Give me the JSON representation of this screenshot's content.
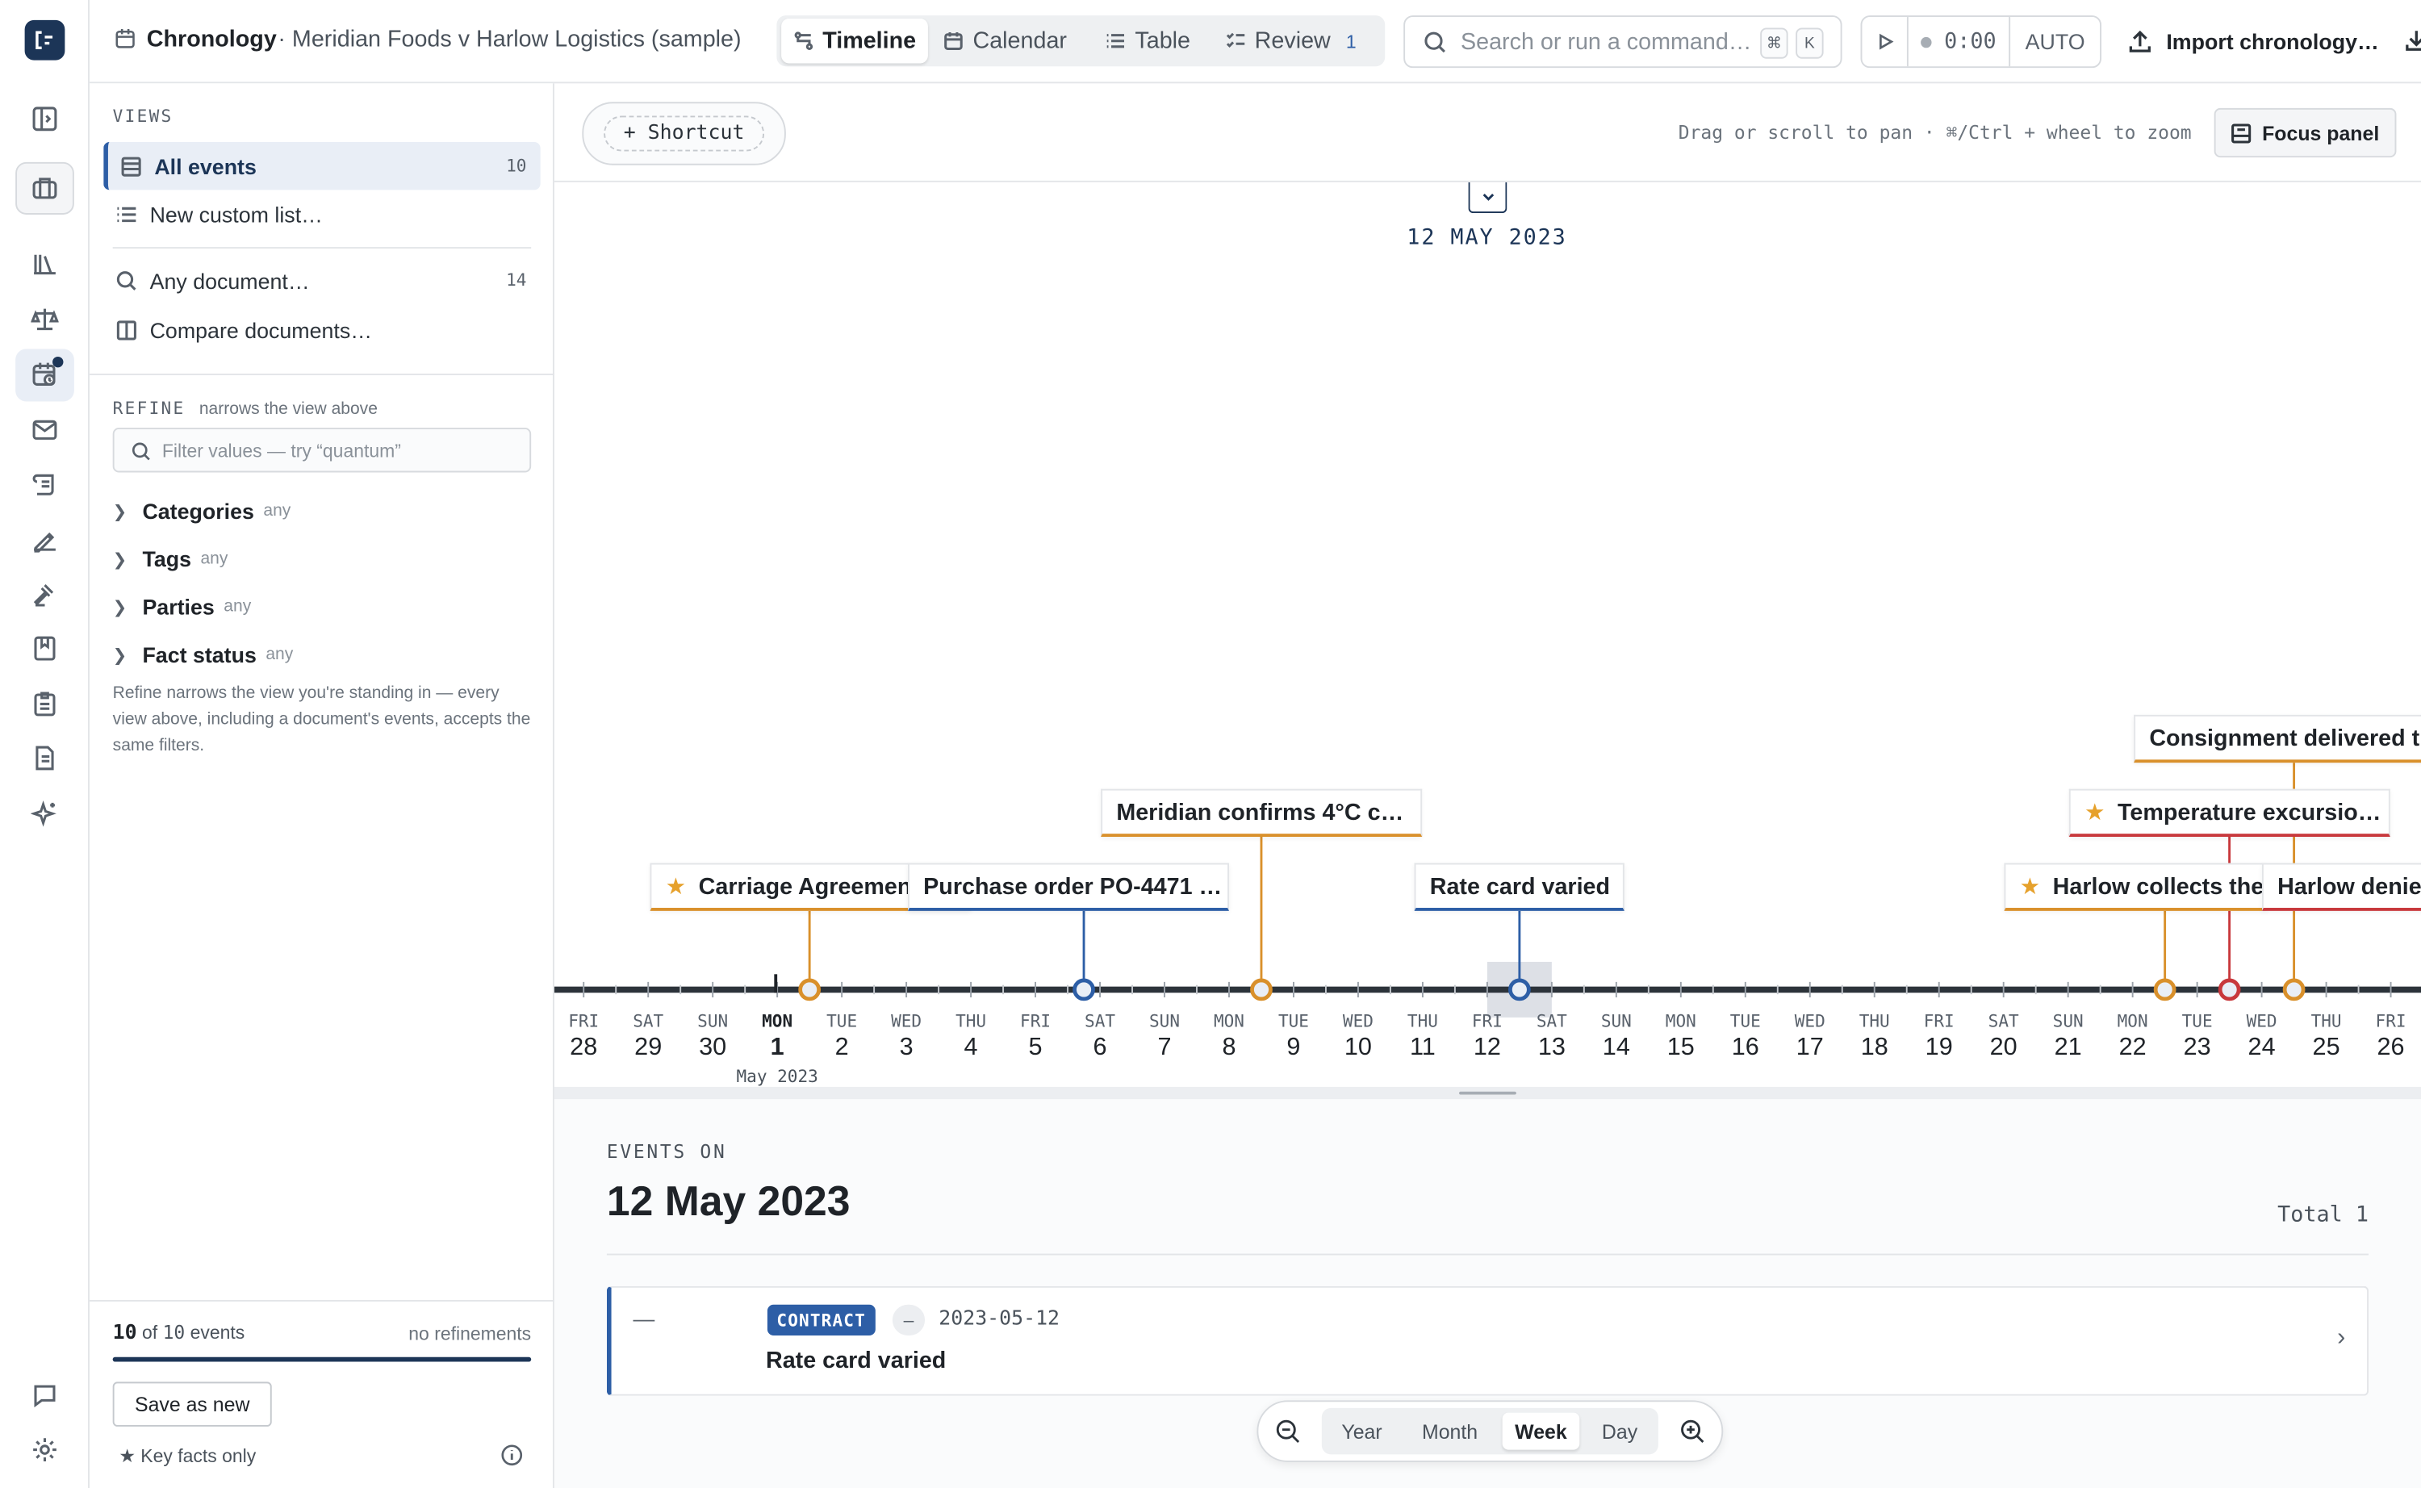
{
  "app": {
    "title": "Chronology",
    "matter": "· Meridian Foods v Harlow Logistics (sample)"
  },
  "view_tabs": [
    {
      "label": "Timeline",
      "icon": "timeline-icon",
      "active": true
    },
    {
      "label": "Calendar",
      "icon": "calendar-icon"
    },
    {
      "label": "Table",
      "icon": "table-icon"
    },
    {
      "label": "Review",
      "icon": "review-icon",
      "count": "1"
    }
  ],
  "search": {
    "placeholder": "Search or run a command…",
    "kbd1": "⌘",
    "kbd2": "K"
  },
  "recorder": {
    "time": "0:00",
    "mode": "AUTO"
  },
  "import": {
    "label": "Import chronology…"
  },
  "sidebar": {
    "views_label": "VIEWS",
    "items": [
      {
        "label": "All events",
        "count": "10",
        "icon": "table-icon",
        "active": true
      },
      {
        "label": "New custom list…",
        "icon": "list-icon"
      }
    ],
    "doc_items": [
      {
        "label": "Any document…",
        "count": "14",
        "icon": "search-icon"
      },
      {
        "label": "Compare documents…",
        "icon": "columns-icon"
      }
    ],
    "refine_label": "REFINE",
    "refine_sub": "narrows the view above",
    "filter_placeholder": "Filter values — try “quantum”",
    "facets": [
      {
        "label": "Categories",
        "hint": "any"
      },
      {
        "label": "Tags",
        "hint": "any"
      },
      {
        "label": "Parties",
        "hint": "any"
      },
      {
        "label": "Fact status",
        "hint": "any"
      }
    ],
    "refine_help": "Refine narrows the view you're standing in — every view above, including a document's events, accepts the same filters.",
    "footer": {
      "shown": "10",
      "of_text": "of",
      "total": "10",
      "events_text": "events",
      "status": "no refinements",
      "progress": 1.0,
      "save_label": "Save as new",
      "key_facts": "★ Key facts only"
    }
  },
  "timeline": {
    "shortcut_label": "+ Shortcut",
    "pan_hint": "Drag or scroll to pan · ⌘/Ctrl + wheel to zoom",
    "focus_label": "Focus panel",
    "focus_date": "12 MAY 2023",
    "month_label": "May 2023",
    "days": [
      {
        "dow": "FRI",
        "day": "28"
      },
      {
        "dow": "SAT",
        "day": "29"
      },
      {
        "dow": "SUN",
        "day": "30"
      },
      {
        "dow": "MON",
        "day": "1",
        "bold": true
      },
      {
        "dow": "TUE",
        "day": "2"
      },
      {
        "dow": "WED",
        "day": "3"
      },
      {
        "dow": "THU",
        "day": "4"
      },
      {
        "dow": "FRI",
        "day": "5"
      },
      {
        "dow": "SAT",
        "day": "6"
      },
      {
        "dow": "SUN",
        "day": "7"
      },
      {
        "dow": "MON",
        "day": "8"
      },
      {
        "dow": "TUE",
        "day": "9"
      },
      {
        "dow": "WED",
        "day": "10"
      },
      {
        "dow": "THU",
        "day": "11"
      },
      {
        "dow": "FRI",
        "day": "12"
      },
      {
        "dow": "SAT",
        "day": "13"
      },
      {
        "dow": "SUN",
        "day": "14"
      },
      {
        "dow": "MON",
        "day": "15"
      },
      {
        "dow": "TUE",
        "day": "16"
      },
      {
        "dow": "WED",
        "day": "17"
      },
      {
        "dow": "THU",
        "day": "18"
      },
      {
        "dow": "FRI",
        "day": "19"
      },
      {
        "dow": "SAT",
        "day": "20"
      },
      {
        "dow": "SUN",
        "day": "21"
      },
      {
        "dow": "MON",
        "day": "22"
      },
      {
        "dow": "TUE",
        "day": "23"
      },
      {
        "dow": "WED",
        "day": "24"
      },
      {
        "dow": "THU",
        "day": "25"
      },
      {
        "dow": "FRI",
        "day": "26"
      }
    ],
    "colors": {
      "contract": "#2d5ea6",
      "operational": "#d9902b",
      "dispute": "#c8383c",
      "axis": "#2c333a"
    },
    "events": [
      {
        "label": "Carriage Agreemen",
        "key": true,
        "color": "#d9902b"
      },
      {
        "label": "Purchase order PO-4471 …",
        "color": "#2d5ea6"
      },
      {
        "label": "Meridian confirms 4°C c…",
        "color": "#d9902b"
      },
      {
        "label": "Rate card varied",
        "color": "#2d5ea6"
      },
      {
        "label": "Harlow collects the",
        "key": true,
        "color": "#d9902b"
      },
      {
        "label": "Temperature excursio…",
        "key": true,
        "color": "#c8383c"
      },
      {
        "label": "Consignment delivered t",
        "color": "#d9902b"
      },
      {
        "label": "Harlow denie",
        "color": "#c8383c"
      }
    ]
  },
  "events_panel": {
    "heading": "EVENTS ON",
    "date": "12 May 2023",
    "total": "Total 1",
    "card": {
      "lead": "—",
      "category": "CONTRACT",
      "dash": "–",
      "iso": "2023-05-12",
      "title": "Rate card varied"
    }
  },
  "zoom": {
    "levels": [
      "Year",
      "Month",
      "Week",
      "Day"
    ],
    "active": "Week"
  }
}
